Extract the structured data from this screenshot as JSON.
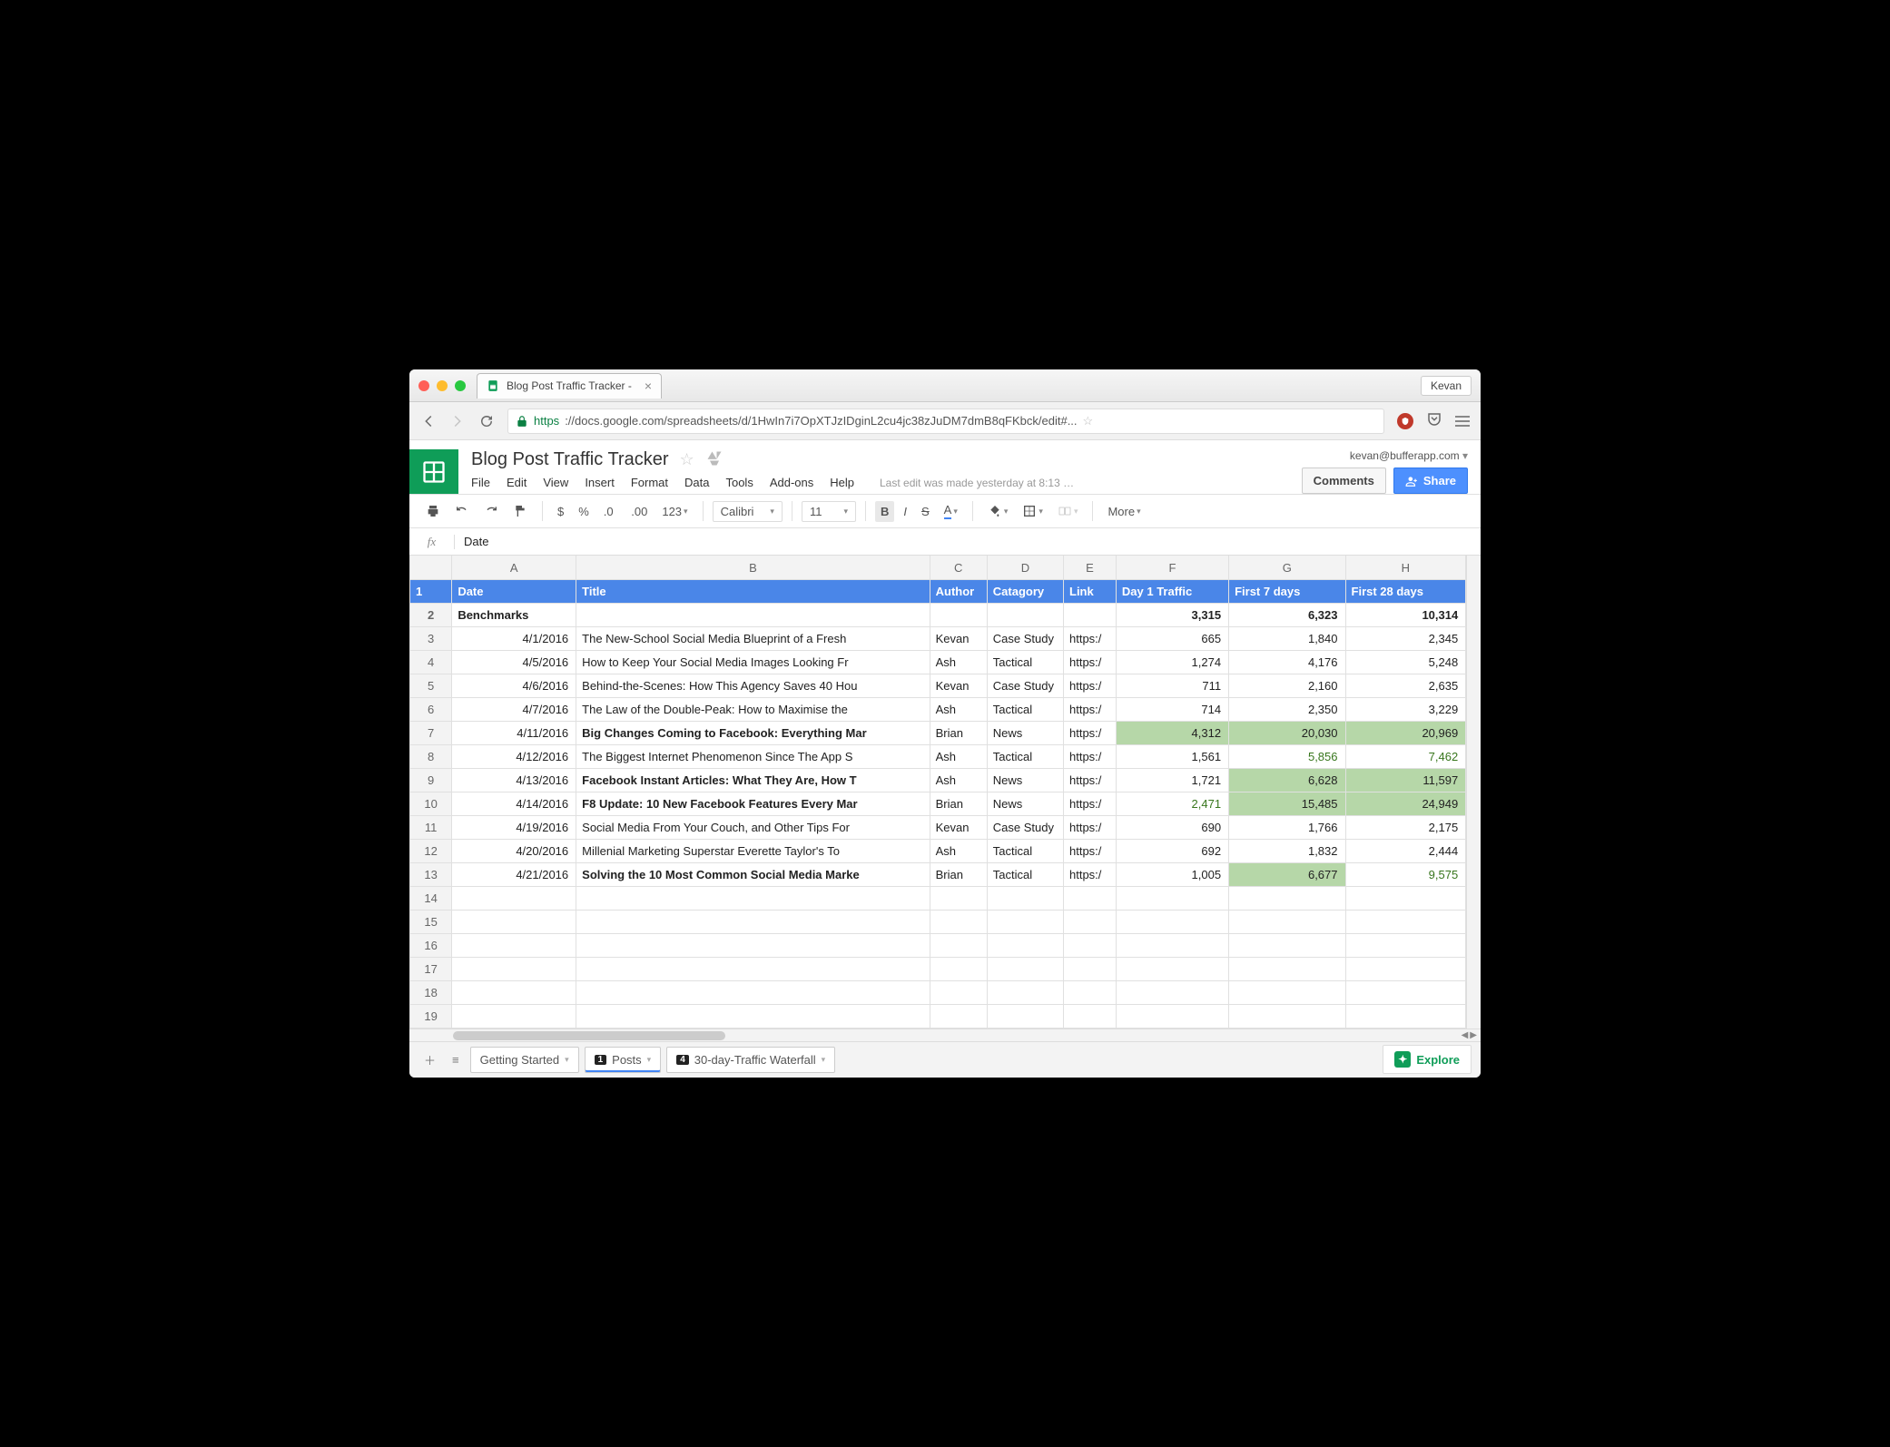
{
  "browser": {
    "profile": "Kevan",
    "tab_title": "Blog Post Traffic Tracker - ",
    "url_scheme": "https",
    "url_rest": "://docs.google.com/spreadsheets/d/1HwIn7i7OpXTJzIDginL2cu4jc38zJuDM7dmB8qFKbck/edit#..."
  },
  "docs": {
    "title": "Blog Post Traffic Tracker",
    "account": "kevan@bufferapp.com",
    "comments_label": "Comments",
    "share_label": "Share",
    "menus": [
      "File",
      "Edit",
      "View",
      "Insert",
      "Format",
      "Data",
      "Tools",
      "Add-ons",
      "Help"
    ],
    "last_edit": "Last edit was made yesterday at 8:13 …",
    "font_name": "Calibri",
    "font_size": "11",
    "number_format": "123",
    "more_label": "More"
  },
  "fx": {
    "value": "Date"
  },
  "columns": [
    "A",
    "B",
    "C",
    "D",
    "E",
    "F",
    "G",
    "H"
  ],
  "headers": {
    "date": "Date",
    "title": "Title",
    "author": "Author",
    "category": "Catagory",
    "link": "Link",
    "day1": "Day 1 Traffic",
    "first7": "First 7 days",
    "first28": "First 28 days"
  },
  "benchmarks": {
    "label": "Benchmarks",
    "day1": "3,315",
    "first7": "6,323",
    "first28": "10,314"
  },
  "rows": [
    {
      "date": "4/1/2016",
      "title": "The New-School Social Media Blueprint of a Fresh",
      "author": "Kevan",
      "category": "Case Study",
      "link": "https:/",
      "day1": "665",
      "first7": "1,840",
      "first28": "2,345",
      "bold": false,
      "hl": [],
      "green": []
    },
    {
      "date": "4/5/2016",
      "title": "How to Keep Your Social Media Images Looking Fr",
      "author": "Ash",
      "category": "Tactical",
      "link": "https:/",
      "day1": "1,274",
      "first7": "4,176",
      "first28": "5,248",
      "bold": false,
      "hl": [],
      "green": []
    },
    {
      "date": "4/6/2016",
      "title": "Behind-the-Scenes: How This Agency Saves 40 Hou",
      "author": "Kevan",
      "category": "Case Study",
      "link": "https:/",
      "day1": "711",
      "first7": "2,160",
      "first28": "2,635",
      "bold": false,
      "hl": [],
      "green": []
    },
    {
      "date": "4/7/2016",
      "title": "The Law of the Double-Peak: How to Maximise the",
      "author": "Ash",
      "category": "Tactical",
      "link": "https:/",
      "day1": "714",
      "first7": "2,350",
      "first28": "3,229",
      "bold": false,
      "hl": [],
      "green": []
    },
    {
      "date": "4/11/2016",
      "title": "Big Changes Coming to Facebook: Everything Mar",
      "author": "Brian",
      "category": "News",
      "link": "https:/",
      "day1": "4,312",
      "first7": "20,030",
      "first28": "20,969",
      "bold": true,
      "hl": [
        "day1",
        "first7",
        "first28"
      ],
      "green": []
    },
    {
      "date": "4/12/2016",
      "title": "The Biggest Internet Phenomenon Since The App S",
      "author": "Ash",
      "category": "Tactical",
      "link": "https:/",
      "day1": "1,561",
      "first7": "5,856",
      "first28": "7,462",
      "bold": false,
      "hl": [],
      "green": [
        "first7",
        "first28"
      ]
    },
    {
      "date": "4/13/2016",
      "title": "Facebook Instant Articles: What They Are, How T",
      "author": "Ash",
      "category": "News",
      "link": "https:/",
      "day1": "1,721",
      "first7": "6,628",
      "first28": "11,597",
      "bold": true,
      "hl": [
        "first7",
        "first28"
      ],
      "green": []
    },
    {
      "date": "4/14/2016",
      "title": "F8 Update: 10 New Facebook Features Every Mar",
      "author": "Brian",
      "category": "News",
      "link": "https:/",
      "day1": "2,471",
      "first7": "15,485",
      "first28": "24,949",
      "bold": true,
      "hl": [
        "first7",
        "first28"
      ],
      "green": [
        "day1"
      ]
    },
    {
      "date": "4/19/2016",
      "title": "Social Media From Your Couch, and Other Tips For",
      "author": "Kevan",
      "category": "Case Study",
      "link": "https:/",
      "day1": "690",
      "first7": "1,766",
      "first28": "2,175",
      "bold": false,
      "hl": [],
      "green": []
    },
    {
      "date": "4/20/2016",
      "title": "Millenial Marketing Superstar Everette Taylor's To",
      "author": "Ash",
      "category": "Tactical",
      "link": "https:/",
      "day1": "692",
      "first7": "1,832",
      "first28": "2,444",
      "bold": false,
      "hl": [],
      "green": []
    },
    {
      "date": "4/21/2016",
      "title": "Solving the 10 Most Common Social Media Marke",
      "author": "Brian",
      "category": "Tactical",
      "link": "https:/",
      "day1": "1,005",
      "first7": "6,677",
      "first28": "9,575",
      "bold": true,
      "hl": [
        "first7"
      ],
      "green": [
        "first28"
      ]
    }
  ],
  "empty_rows": [
    14,
    15,
    16,
    17,
    18,
    19
  ],
  "sheet_tabs": {
    "t1": "Getting Started",
    "t2": "Posts",
    "t2_badge": "1",
    "t3": "30-day-Traffic Waterfall",
    "t3_badge": "4"
  },
  "explore_label": "Explore"
}
